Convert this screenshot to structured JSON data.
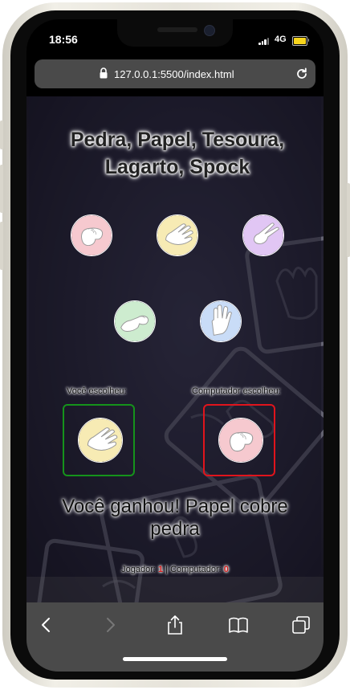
{
  "status_bar": {
    "time": "18:56",
    "network": "4G"
  },
  "browser": {
    "url": "127.0.0.1:5500/index.html"
  },
  "game": {
    "title_line1": "Pedra, Papel, Tesoura,",
    "title_line2": "Lagarto, Spock",
    "choices": [
      {
        "id": "pedra",
        "icon": "rock-hand-icon",
        "color": "#f6c9cf"
      },
      {
        "id": "papel",
        "icon": "paper-hand-icon",
        "color": "#f7ebb4"
      },
      {
        "id": "tesoura",
        "icon": "scissors-hand-icon",
        "color": "#e1c6f4"
      },
      {
        "id": "lagarto",
        "icon": "lizard-hand-icon",
        "color": "#cdeccf"
      },
      {
        "id": "spock",
        "icon": "spock-hand-icon",
        "color": "#c9dcf7"
      }
    ],
    "player_label": "Você escolheu:",
    "computer_label": "Computador escolheu:",
    "player_choice": {
      "icon": "paper-hand-icon",
      "color": "#f7ebb4",
      "border": "#15931b"
    },
    "computer_choice": {
      "icon": "rock-hand-icon",
      "color": "#f6c9cf",
      "border": "#e0141c"
    },
    "result_line1": "Você ganhou! Papel cobre",
    "result_line2": "pedra",
    "score": {
      "player_label": "Jogador:",
      "player_score": "1",
      "separator": "|",
      "computer_label": "Computador:",
      "computer_score": "0"
    }
  },
  "toolbar": {
    "icons": [
      "back-icon",
      "forward-icon",
      "share-icon",
      "bookmarks-icon",
      "tabs-icon"
    ]
  }
}
